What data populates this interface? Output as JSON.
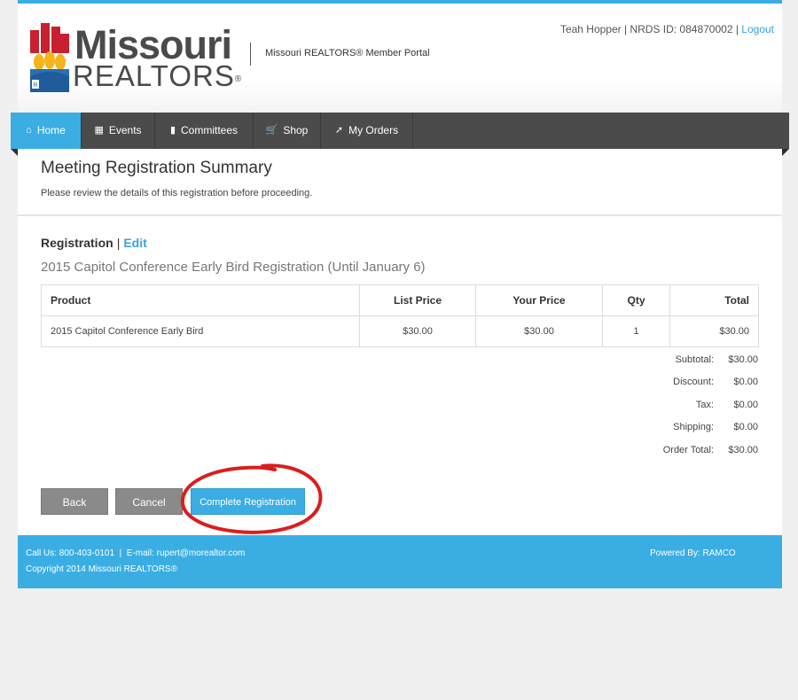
{
  "header": {
    "logo_line1": "Missouri",
    "logo_line2": "REALTORS",
    "logo_mark": "®",
    "portal_title": "Missouri REALTORS® Member Portal",
    "user_info": "Teah Hopper | NRDS ID: 084870002 |",
    "logout_label": "Logout"
  },
  "nav": {
    "items": [
      {
        "label": "Home",
        "icon": "home-icon"
      },
      {
        "label": "Events",
        "icon": "calendar-icon"
      },
      {
        "label": "Committees",
        "icon": "comment-icon"
      },
      {
        "label": "Shop",
        "icon": "cart-icon"
      },
      {
        "label": "My Orders",
        "icon": "pin-icon"
      }
    ],
    "active": "Home"
  },
  "page": {
    "title": "Meeting Registration Summary",
    "subtitle": "Please review the details of this registration before proceeding."
  },
  "registration": {
    "label": "Registration",
    "separator": "|",
    "edit_label": "Edit",
    "name": "2015 Capitol Conference Early Bird Registration (Until January 6)"
  },
  "table": {
    "headers": [
      "Product",
      "List Price",
      "Your Price",
      "Qty",
      "Total"
    ],
    "rows": [
      [
        "2015 Capitol Conference Early Bird",
        "$30.00",
        "$30.00",
        "1",
        "$30.00"
      ]
    ]
  },
  "totals": [
    {
      "label": "Subtotal:",
      "value": "$30.00"
    },
    {
      "label": "Discount:",
      "value": "$0.00"
    },
    {
      "label": "Tax:",
      "value": "$0.00"
    },
    {
      "label": "Shipping:",
      "value": "$0.00"
    },
    {
      "label": "Order Total:",
      "value": "$30.00"
    }
  ],
  "buttons": {
    "back": "Back",
    "cancel": "Cancel",
    "complete": "Complete Registration"
  },
  "footer": {
    "contact": "Call Us: 800-403-0101  |  E-mail: rupert@morealtor.com",
    "copyright": "Copyright 2014 Missouri REALTORS®",
    "powered": "Powered By: RAMCO"
  },
  "colors": {
    "accent": "#3aaee2",
    "nav_bg": "#4b4b4b",
    "button_gray": "#8a8a8a",
    "highlight_circle": "#d91e1e"
  }
}
